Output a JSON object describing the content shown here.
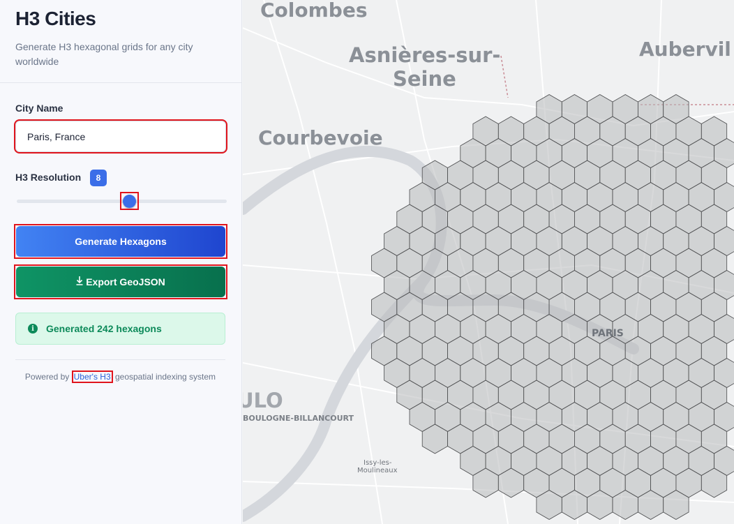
{
  "app": {
    "title": "H3 Cities",
    "subtitle": "Generate H3 hexagonal grids for any city worldwide"
  },
  "form": {
    "city_label": "City Name",
    "city_value": "Paris, France",
    "resolution_label": "H3 Resolution",
    "resolution_value": "8",
    "resolution_min": 0,
    "resolution_max": 15,
    "generate_label": "Generate Hexagons",
    "export_label": "Export GeoJSON"
  },
  "status": {
    "message": "Generated 242 hexagons",
    "icon": "info-icon"
  },
  "footer": {
    "prefix": "Powered by",
    "link_text": "Uber's H3",
    "suffix": "geospatial indexing system"
  },
  "map": {
    "places": {
      "colombes": "Colombes",
      "asnieres_1": "Asnières-sur-",
      "asnieres_2": "Seine",
      "courbevoie": "Courbevoie",
      "aubervilliers": "Aubervil",
      "paris": "PARIS",
      "boulogne": "BOULOGNE-BILLANCOURT",
      "boulogne_big": "ULO",
      "issy_1": "Issy-les-",
      "issy_2": "Moulineaux"
    },
    "colors": {
      "hex_fill": "#b8b9bb",
      "hex_stroke": "#4a4b4d",
      "river": "#d4d7dc",
      "background": "#f0f1f2"
    }
  },
  "colors": {
    "accent": "#3b6ee8",
    "success": "#0d8a5a",
    "export": "#0f8a5f",
    "highlight": "#e0141c"
  }
}
